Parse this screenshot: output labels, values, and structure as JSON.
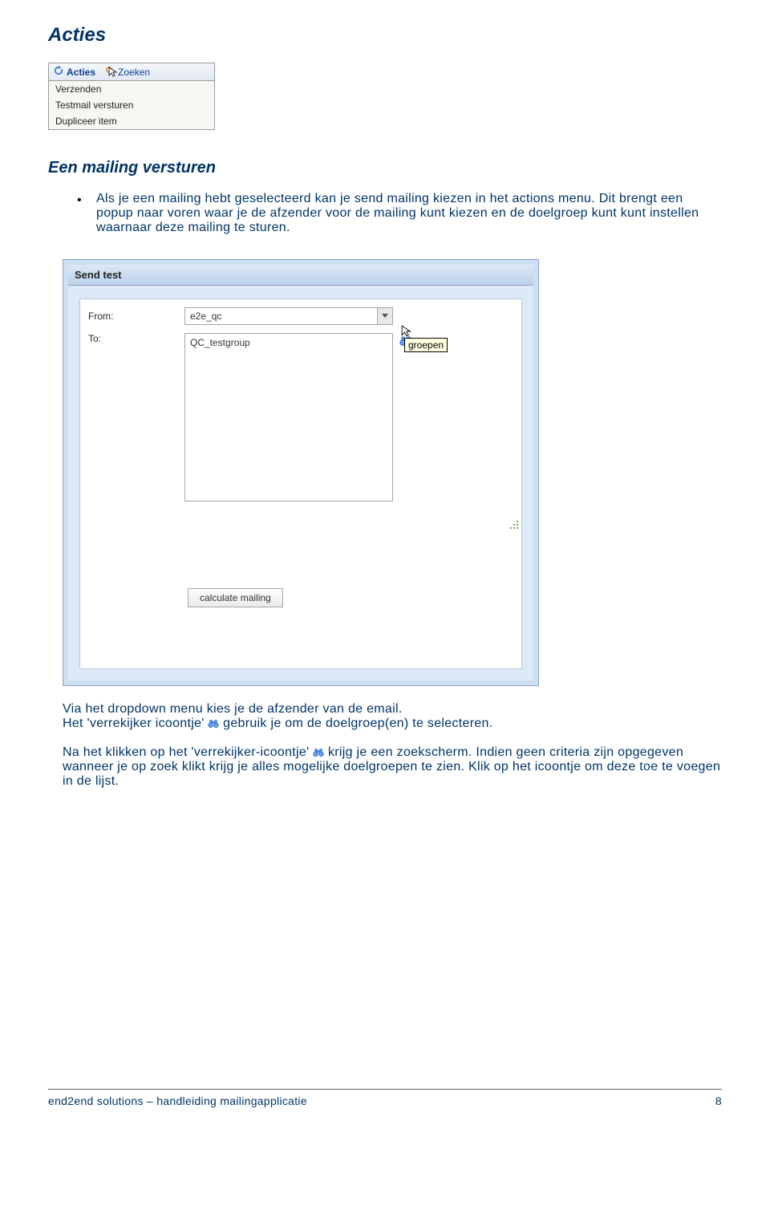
{
  "heading": "Acties",
  "menu": {
    "tabs": {
      "acties": "Acties",
      "zoeken": "Zoeken"
    },
    "items": [
      "Verzenden",
      "Testmail versturen",
      "Dupliceer item"
    ]
  },
  "subheading": "Een mailing versturen",
  "bullet": "Als je een mailing hebt geselecteerd kan je send mailing kiezen in het actions menu. Dit brengt een popup naar voren waar je de afzender voor de mailing kunt kiezen en de doelgroep kunt  kunt instellen waarnaar deze mailing te sturen.",
  "dialog": {
    "title": "Send test",
    "from_label": "From:",
    "to_label": "To:",
    "from_value": "e2e_qc",
    "to_value": "QC_testgroup",
    "tooltip": "groepen",
    "calc_button": "calculate mailing"
  },
  "para2a": "Via het dropdown menu kies je de afzender van de email.",
  "para2b_pre": "Het 'verrekijker icoontje' ",
  "para2b_post": " gebruik je om de doelgroep(en) te selecteren.",
  "para3_pre": "Na het klikken op het 'verrekijker-icoontje' ",
  "para3_post": " krijg je een zoekscherm. Indien geen criteria zijn opgegeven wanneer je op zoek klikt krijg je alles mogelijke doelgroepen te zien. Klik op het icoontje om deze toe te voegen in de lijst.",
  "footer_text": "end2end solutions – handleiding mailingapplicatie",
  "page_num": "8"
}
